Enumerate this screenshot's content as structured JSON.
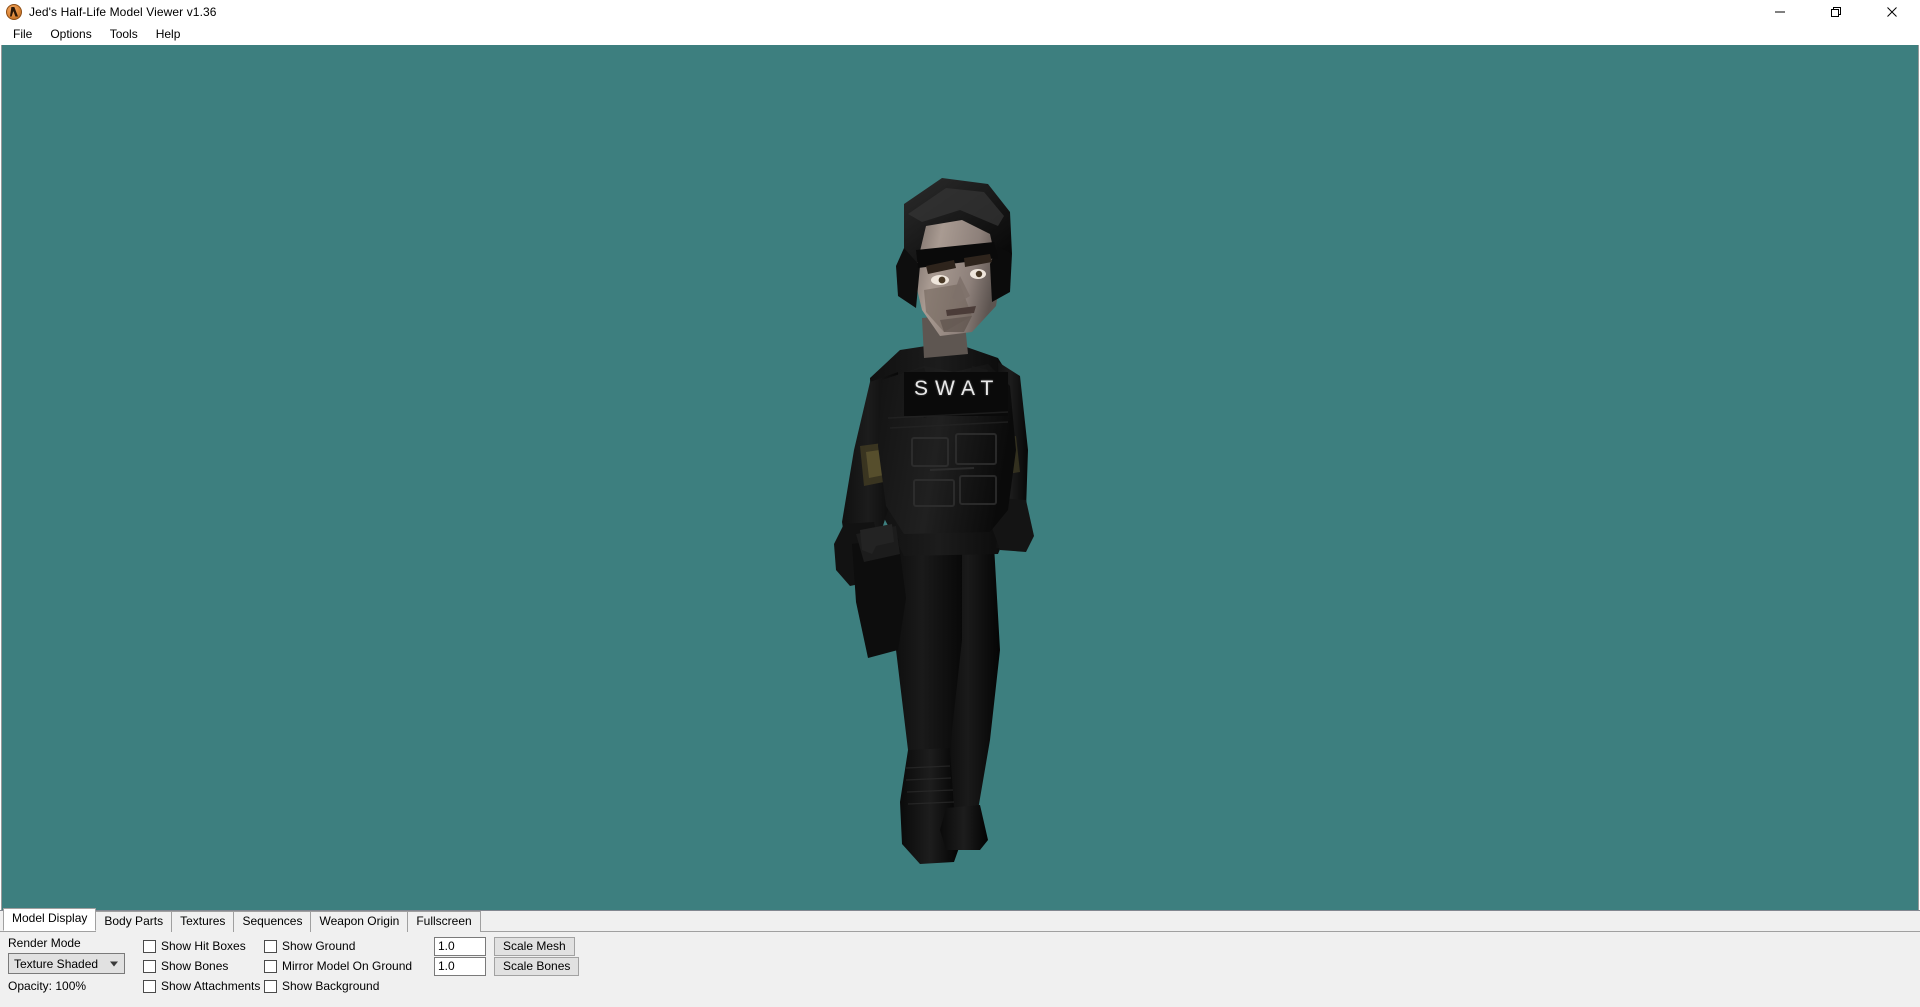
{
  "window": {
    "title": "Jed's Half-Life Model Viewer v1.36",
    "icon": "app-lambda-icon",
    "controls": [
      {
        "name": "minimize",
        "glyph": "minimize-icon"
      },
      {
        "name": "maximize",
        "glyph": "maximize-icon"
      },
      {
        "name": "close",
        "glyph": "close-icon"
      }
    ]
  },
  "menubar": {
    "items": [
      {
        "label": "File"
      },
      {
        "label": "Options"
      },
      {
        "label": "Tools"
      },
      {
        "label": "Help"
      }
    ]
  },
  "viewport": {
    "background_color": "#3d7f7f",
    "model_name": "swat-officer-model",
    "model_text": "SWAT"
  },
  "panel": {
    "tabs": [
      {
        "label": "Model Display",
        "active": true
      },
      {
        "label": "Body Parts",
        "active": false
      },
      {
        "label": "Textures",
        "active": false
      },
      {
        "label": "Sequences",
        "active": false
      },
      {
        "label": "Weapon Origin",
        "active": false
      },
      {
        "label": "Fullscreen",
        "active": false
      }
    ],
    "render_mode": {
      "label": "Render Mode",
      "value": "Texture Shaded"
    },
    "opacity": {
      "label": "Opacity: 100%"
    },
    "checkbox_column_1": [
      {
        "label": "Show Hit Boxes",
        "checked": false
      },
      {
        "label": "Show Bones",
        "checked": false
      },
      {
        "label": "Show Attachments",
        "checked": false
      }
    ],
    "checkbox_column_2": [
      {
        "label": "Show Ground",
        "checked": false
      },
      {
        "label": "Mirror Model On Ground",
        "checked": false
      },
      {
        "label": "Show Background",
        "checked": false
      }
    ],
    "scale_controls": [
      {
        "value": "1.0",
        "button": "Scale Mesh"
      },
      {
        "value": "1.0",
        "button": "Scale Bones"
      }
    ]
  }
}
